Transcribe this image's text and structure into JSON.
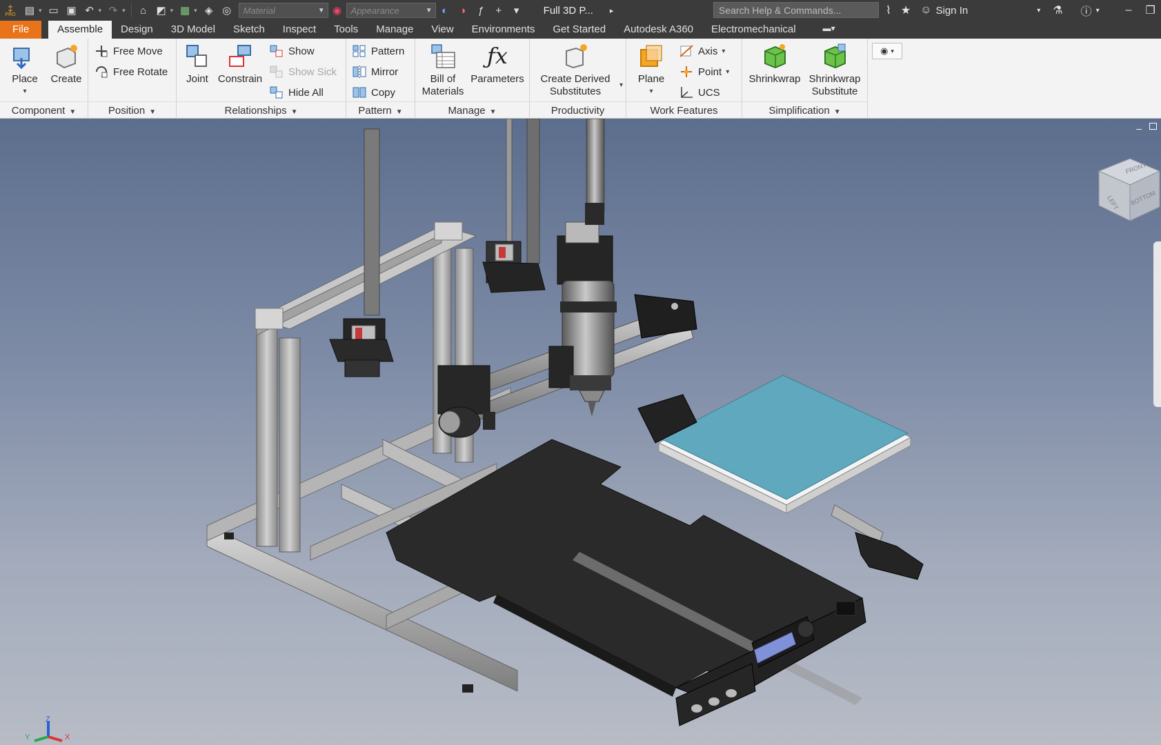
{
  "app": {
    "logo_text": "PRO"
  },
  "qat": {
    "material_placeholder": "Material",
    "appearance_placeholder": "Appearance",
    "document_title": "Full 3D P...",
    "search_placeholder": "Search Help & Commands...",
    "sign_in": "Sign In"
  },
  "tabs": [
    "File",
    "Assemble",
    "Design",
    "3D Model",
    "Sketch",
    "Inspect",
    "Tools",
    "Manage",
    "View",
    "Environments",
    "Get Started",
    "Autodesk A360",
    "Electromechanical"
  ],
  "active_tab": "Assemble",
  "ribbon": {
    "component": {
      "title": "Component",
      "place": "Place",
      "create": "Create"
    },
    "position": {
      "title": "Position",
      "free_move": "Free Move",
      "free_rotate": "Free Rotate"
    },
    "relationships": {
      "title": "Relationships",
      "joint": "Joint",
      "constrain": "Constrain",
      "show": "Show",
      "show_sick": "Show Sick",
      "hide_all": "Hide All"
    },
    "pattern": {
      "title": "Pattern",
      "pattern": "Pattern",
      "mirror": "Mirror",
      "copy": "Copy"
    },
    "manage": {
      "title": "Manage",
      "bom_line1": "Bill of",
      "bom_line2": "Materials",
      "parameters": "Parameters"
    },
    "productivity": {
      "title": "Productivity",
      "line1": "Create Derived",
      "line2": "Substitutes"
    },
    "work_features": {
      "title": "Work Features",
      "plane": "Plane",
      "axis": "Axis",
      "point": "Point",
      "ucs": "UCS"
    },
    "simplification": {
      "title": "Simplification",
      "shrinkwrap": "Shrinkwrap",
      "shrinkwrap_sub_line1": "Shrinkwrap",
      "shrinkwrap_sub_line2": "Substitute"
    }
  },
  "viewcube": {
    "faces": [
      "FRONT",
      "LEFT",
      "BOTTOM"
    ]
  },
  "triad": {
    "axes": [
      "X",
      "Y",
      "Z"
    ]
  },
  "colors": {
    "file_tab": "#e8731a",
    "ribbon_bg": "#f3f3f3",
    "dark_chrome": "#3b3b3b",
    "bed_surface": "#5fa8bd",
    "aluminum": "#a9a9a9",
    "black_parts": "#262626"
  }
}
